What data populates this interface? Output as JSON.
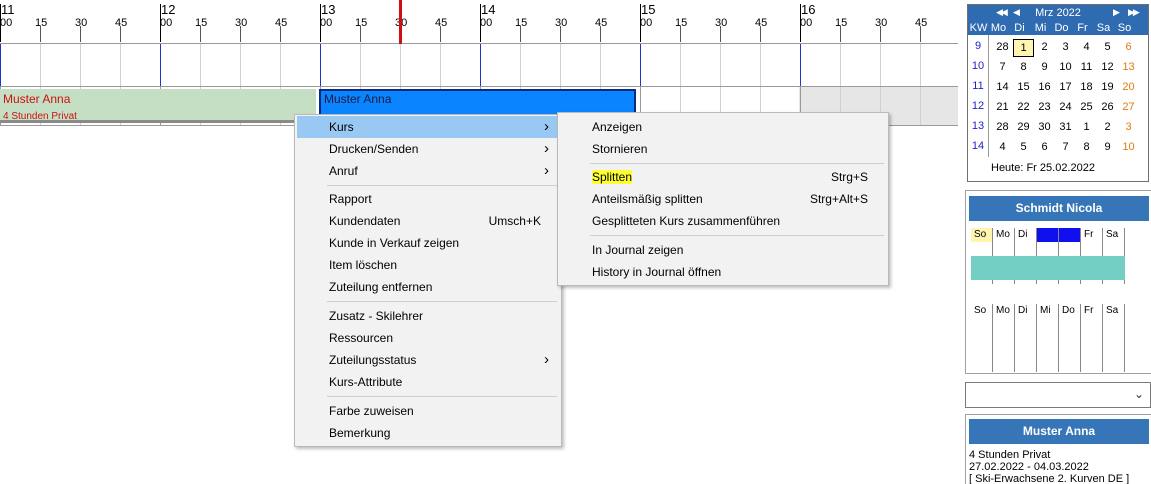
{
  "timeline": {
    "hours": [
      {
        "label": "11",
        "minutes": [
          "00",
          "15",
          "30",
          "45"
        ]
      },
      {
        "label": "12",
        "minutes": [
          "00",
          "15",
          "30",
          "45"
        ]
      },
      {
        "label": "13",
        "minutes": [
          "00",
          "15",
          "30",
          "45"
        ]
      },
      {
        "label": "14",
        "minutes": [
          "00",
          "15",
          "30",
          "45"
        ]
      },
      {
        "label": "15",
        "minutes": [
          "00",
          "15",
          "30",
          "45"
        ]
      },
      {
        "label": "16",
        "minutes": [
          "00",
          "15",
          "30",
          "45"
        ]
      }
    ],
    "now_color": "#d01010"
  },
  "bookings": {
    "green": {
      "name": "Muster Anna",
      "sub": "4 Stunden Privat",
      "color": "#c4dfc4",
      "text_color": "#d01010"
    },
    "blue": {
      "name": "Muster Anna",
      "color": "#0a84ff"
    }
  },
  "context_menu": {
    "items": [
      {
        "label": "Kurs",
        "shortcut": "",
        "submenu": true
      },
      {
        "label": "Drucken/Senden",
        "shortcut": "",
        "submenu": true
      },
      {
        "label": "Anruf",
        "shortcut": "",
        "submenu": true
      },
      {
        "label": "Rapport",
        "shortcut": "",
        "submenu": false
      },
      {
        "label": "Kundendaten",
        "shortcut": "Umsch+K",
        "submenu": false
      },
      {
        "label": "Kunde in Verkauf zeigen",
        "shortcut": "",
        "submenu": false
      },
      {
        "label": "Item löschen",
        "shortcut": "",
        "submenu": false
      },
      {
        "label": "Zuteilung entfernen",
        "shortcut": "",
        "submenu": false
      },
      {
        "label": "Zusatz - Skilehrer",
        "shortcut": "",
        "submenu": false
      },
      {
        "label": "Ressourcen",
        "shortcut": "",
        "submenu": false
      },
      {
        "label": "Zuteilungsstatus",
        "shortcut": "",
        "submenu": true
      },
      {
        "label": "Kurs-Attribute",
        "shortcut": "",
        "submenu": false
      },
      {
        "label": "Farbe zuweisen",
        "shortcut": "",
        "submenu": false
      },
      {
        "label": "Bemerkung",
        "shortcut": "",
        "submenu": false
      }
    ]
  },
  "sub_menu": {
    "items": [
      {
        "label": "Anzeigen",
        "shortcut": ""
      },
      {
        "label": "Stornieren",
        "shortcut": ""
      },
      {
        "label": "Splitten",
        "shortcut": "Strg+S"
      },
      {
        "label": "Anteilsmäßig splitten",
        "shortcut": "Strg+Alt+S"
      },
      {
        "label": "Gesplitteten Kurs zusammenführen",
        "shortcut": ""
      },
      {
        "label": "In Journal zeigen",
        "shortcut": ""
      },
      {
        "label": "History in Journal öffnen",
        "shortcut": ""
      }
    ]
  },
  "calendar": {
    "month": "Mrz 2022",
    "nav": {
      "prev_year": "◀◀",
      "prev": "◀",
      "next": "▶",
      "next_year": "▶▶"
    },
    "weekday_headers": [
      "KW",
      "Mo",
      "Di",
      "Mi",
      "Do",
      "Fr",
      "Sa",
      "So"
    ],
    "weeks": [
      {
        "kw": "9",
        "days": [
          "28",
          "1",
          "2",
          "3",
          "4",
          "5",
          "6"
        ]
      },
      {
        "kw": "10",
        "days": [
          "7",
          "8",
          "9",
          "10",
          "11",
          "12",
          "13"
        ]
      },
      {
        "kw": "11",
        "days": [
          "14",
          "15",
          "16",
          "17",
          "18",
          "19",
          "20"
        ]
      },
      {
        "kw": "12",
        "days": [
          "21",
          "22",
          "23",
          "24",
          "25",
          "26",
          "27"
        ]
      },
      {
        "kw": "13",
        "days": [
          "28",
          "29",
          "30",
          "31",
          "1",
          "2",
          "3"
        ]
      },
      {
        "kw": "14",
        "days": [
          "4",
          "5",
          "6",
          "7",
          "8",
          "9",
          "10"
        ]
      }
    ],
    "today_label": "Heute: Fr 25.02.2022",
    "header_color": "#2e6bb0",
    "weekend_color": "#e07a10"
  },
  "employee": {
    "name": "Schmidt Nicola",
    "week_days": [
      "So",
      "Mo",
      "Di",
      "Mi",
      "Do",
      "Fr",
      "Sa"
    ],
    "bar_color": "#73cfc3"
  },
  "combo": {
    "value": "",
    "arrow": "⌄"
  },
  "customer": {
    "name": "Muster Anna",
    "lines": [
      "4 Stunden Privat",
      "27.02.2022 - 04.03.2022",
      "[ Ski-Erwachsene 2. Kurven DE ]"
    ]
  }
}
